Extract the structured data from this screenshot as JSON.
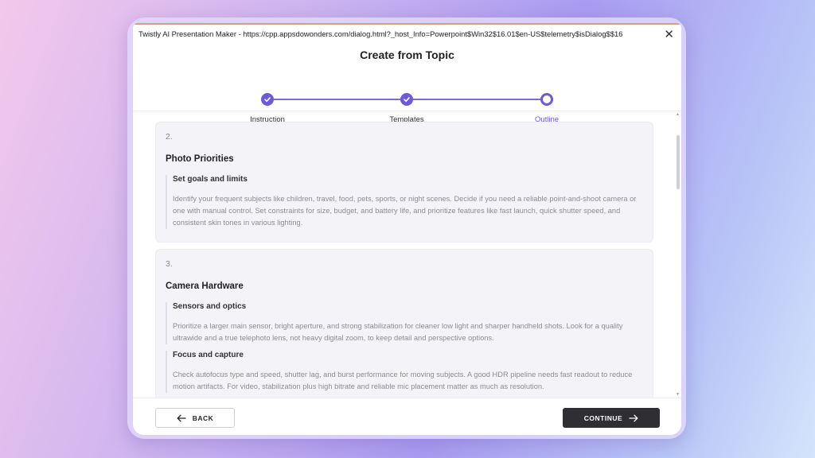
{
  "window": {
    "title": "Twistly AI Presentation Maker - https://cpp.appsdowonders.com/dialog.html?_host_Info=Powerpoint$Win32$16.01$en-US$telemetry$isDialog$$16",
    "close_symbol": "✕"
  },
  "header": {
    "title": "Create from Topic"
  },
  "stepper": {
    "steps": [
      {
        "label": "Instruction",
        "state": "done"
      },
      {
        "label": "Templates",
        "state": "done"
      },
      {
        "label": "Outline",
        "state": "current"
      }
    ]
  },
  "cards": [
    {
      "number": "2.",
      "title": "Photo Priorities",
      "sections": [
        {
          "title": "Set goals and limits",
          "body": "Identify your frequent subjects like children, travel, food, pets, sports, or night scenes. Decide if you need a reliable point-and-shoot camera or one with manual control. Set constraints for size, budget, and battery life, and prioritize features like fast launch, quick shutter speed, and consistent skin tones in various lighting."
        }
      ]
    },
    {
      "number": "3.",
      "title": "Camera Hardware",
      "sections": [
        {
          "title": "Sensors and optics",
          "body": "Prioritize a larger main sensor, bright aperture, and strong stabilization for cleaner low light and sharper handheld shots. Look for a quality ultrawide and a true telephoto lens, not heavy digital zoom, to keep detail and perspective options."
        },
        {
          "title": "Focus and capture",
          "body": "Check autofocus type and speed, shutter lag, and burst performance for moving subjects. A good HDR pipeline needs fast readout to reduce motion artifacts. For video, stabilization plus high bitrate and reliable mic placement matter as much as resolution."
        }
      ]
    }
  ],
  "footer": {
    "back_label": "BACK",
    "continue_label": "CONTINUE"
  },
  "colors": {
    "accent": "#6d5ad6",
    "continue_bg": "#2f2f33"
  }
}
